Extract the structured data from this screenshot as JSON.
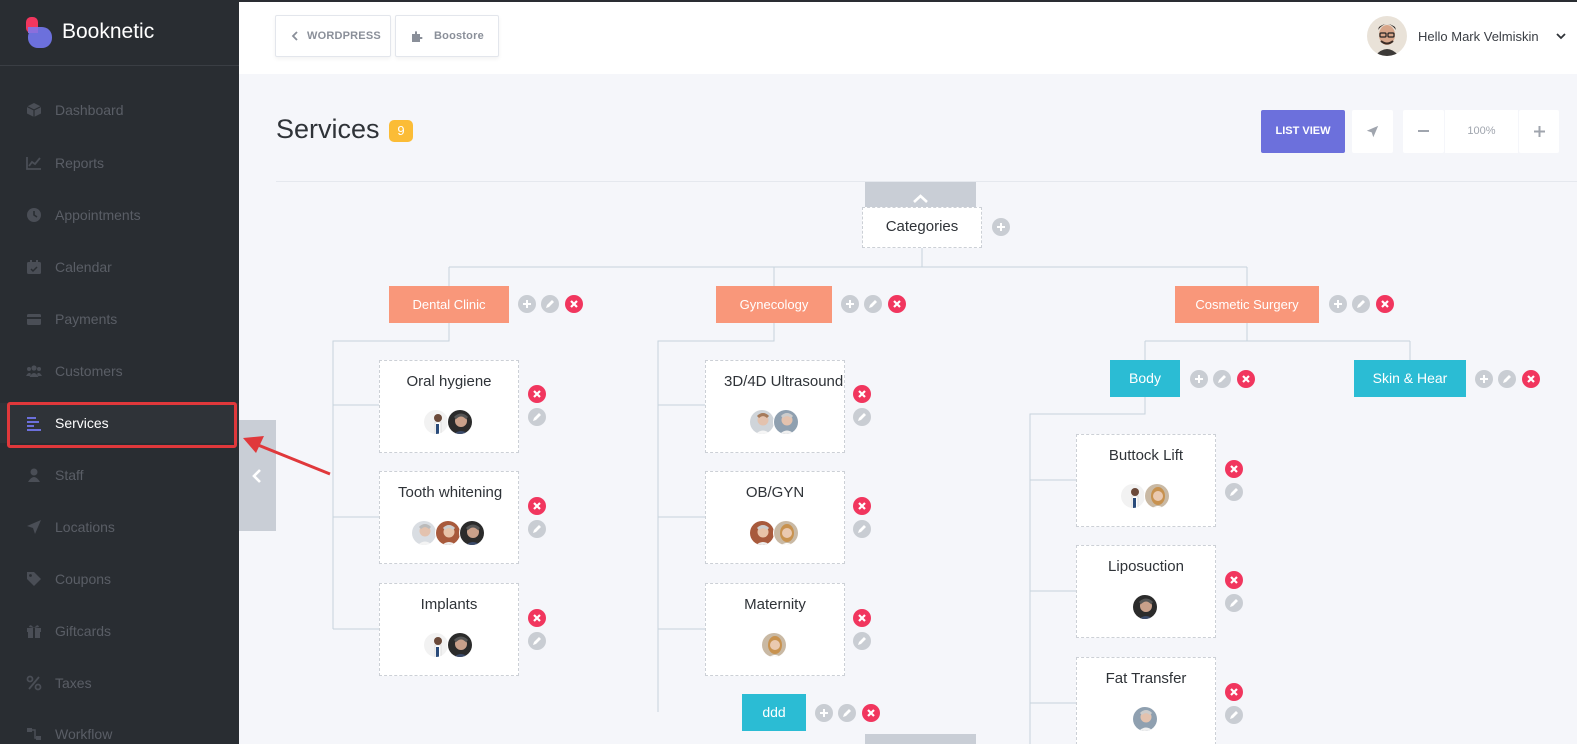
{
  "app": {
    "name": "Booknetic"
  },
  "sidebar": {
    "items": [
      {
        "label": "Dashboard",
        "icon": "cube-icon"
      },
      {
        "label": "Reports",
        "icon": "chart-icon"
      },
      {
        "label": "Appointments",
        "icon": "clock-icon"
      },
      {
        "label": "Calendar",
        "icon": "calendar-icon"
      },
      {
        "label": "Payments",
        "icon": "wallet-icon"
      },
      {
        "label": "Customers",
        "icon": "users-icon"
      },
      {
        "label": "Services",
        "icon": "list-icon",
        "active": true
      },
      {
        "label": "Staff",
        "icon": "user-icon"
      },
      {
        "label": "Locations",
        "icon": "location-arrow-icon"
      },
      {
        "label": "Coupons",
        "icon": "tag-icon"
      },
      {
        "label": "Giftcards",
        "icon": "gift-icon"
      },
      {
        "label": "Taxes",
        "icon": "percent-icon"
      },
      {
        "label": "Workflow",
        "icon": "workflow-icon"
      }
    ]
  },
  "header": {
    "wordpress_label": "WORDPRESS",
    "boostore_label": "Boostore",
    "greeting": "Hello Mark Velmiskin"
  },
  "page": {
    "title": "Services",
    "count": "9",
    "list_view_label": "LIST VIEW",
    "zoom": "100%"
  },
  "tree": {
    "root": "Categories",
    "categories": [
      {
        "name": "Dental Clinic",
        "services": [
          {
            "name": "Oral hygiene"
          },
          {
            "name": "Tooth whitening"
          },
          {
            "name": "Implants"
          }
        ]
      },
      {
        "name": "Gynecology",
        "services": [
          {
            "name": "3D/4D Ultrasound"
          },
          {
            "name": "OB/GYN"
          },
          {
            "name": "Maternity"
          }
        ],
        "subcategories": [
          {
            "name": "ddd"
          }
        ]
      },
      {
        "name": "Cosmetic Surgery",
        "subcategories": [
          {
            "name": "Body",
            "services": [
              {
                "name": "Buttock Lift"
              },
              {
                "name": "Liposuction"
              },
              {
                "name": "Fat Transfer"
              }
            ]
          },
          {
            "name": "Skin & Hear"
          }
        ]
      }
    ]
  },
  "colors": {
    "sidebar_bg": "#292d32",
    "accent_purple": "#6c70dc",
    "category_orange": "#f9977a",
    "subcategory_teal": "#2bbcd4",
    "delete_red": "#f1365e",
    "badge_yellow": "#fbbc36",
    "annotation_red": "#e0383b"
  }
}
